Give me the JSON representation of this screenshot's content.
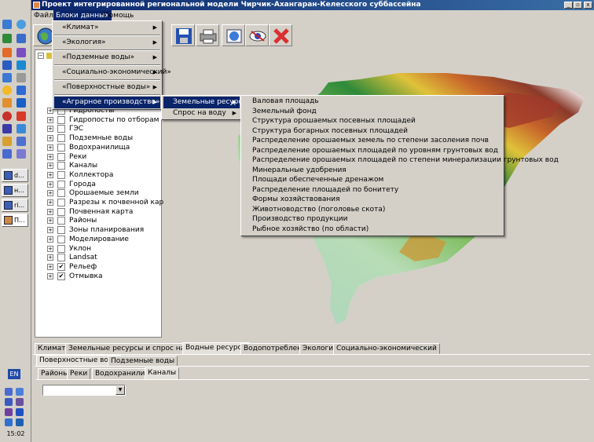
{
  "window": {
    "title": "Проект интегрированной региональной модели Чирчик-Ахангаран-Келесского суббассейна",
    "min": "_",
    "max": "▫",
    "close": "x"
  },
  "menubar": [
    "Файл",
    "Блоки данных",
    "Помощь"
  ],
  "blocks_menu": [
    {
      "label": "«Климат»",
      "arrow": "▶"
    },
    {
      "label": "«Экология»",
      "arrow": "▶"
    },
    {
      "label": "«Подземные воды»",
      "arrow": "▶"
    },
    {
      "label": "«Социально-экономический»",
      "arrow": "▶"
    },
    {
      "label": "«Поверхностные воды»",
      "arrow": "▶"
    },
    {
      "label": "«Аграрное производство»",
      "arrow": "▶"
    }
  ],
  "agrar_menu": [
    {
      "label": "Земельные ресурсы",
      "arrow": "▶"
    },
    {
      "label": "Спрос на воду",
      "arrow": "▶"
    }
  ],
  "land_menu": [
    "Валовая площадь",
    "Земельный фонд",
    "Структура орошаемых посевных площадей",
    "Структура богарных посевных площадей",
    "Распределение орошаемых земель по степени засоления почв",
    "Распределение орошаемых площадей по уровням грунтовых вод",
    "Распределение орошаемых площадей по степени минерализации грунтовых вод",
    "Минеральные удобрения",
    "Площади обеспеченные дренажом",
    "Распределение площадей по бонитету",
    "Формы хозяйствования",
    "Животноводство (поголовье скота)",
    "Производство продукции",
    "Рыбное хозяйство (по области)"
  ],
  "tree": [
    {
      "label": "Гидропосты",
      "checked": false
    },
    {
      "label": "Гидропосты по отборам",
      "checked": false
    },
    {
      "label": "ГЭС",
      "checked": false
    },
    {
      "label": "Подземные воды",
      "checked": false
    },
    {
      "label": "Водохранилища",
      "checked": false
    },
    {
      "label": "Реки",
      "checked": false
    },
    {
      "label": "Каналы",
      "checked": false
    },
    {
      "label": "Коллектора",
      "checked": false
    },
    {
      "label": "Города",
      "checked": false
    },
    {
      "label": "Орошаемые земли",
      "checked": false
    },
    {
      "label": "Разрезы к почвенной карте",
      "checked": false
    },
    {
      "label": "Почвенная карта",
      "checked": false
    },
    {
      "label": "Районы",
      "checked": false
    },
    {
      "label": "Зоны планирования",
      "checked": false
    },
    {
      "label": "Моделирование",
      "checked": false
    },
    {
      "label": "Уклон",
      "checked": false
    },
    {
      "label": "Landsat",
      "checked": false
    },
    {
      "label": "Рельеф",
      "checked": true
    },
    {
      "label": "Отмывка",
      "checked": true
    }
  ],
  "tree_expand": "+",
  "tree_root_expand": "−",
  "check_mark": "✔",
  "tabs_main": [
    "Климат",
    "Земельные ресурсы и спрос на воду",
    "Водные ресурсы",
    "Водопотребление",
    "Экология",
    "Социально-экономический"
  ],
  "tabs_sub": [
    "Поверхностные воды",
    "Подземные воды"
  ],
  "tabs_sub2": [
    "Районы",
    "Реки",
    "Водохранилища",
    "Каналы"
  ],
  "combo": {
    "value": "",
    "arrow": "▼"
  },
  "taskbar": {
    "items": [
      "d...",
      "н...",
      "ri...",
      "П..."
    ],
    "lang": "EN",
    "clock": "15:02"
  }
}
